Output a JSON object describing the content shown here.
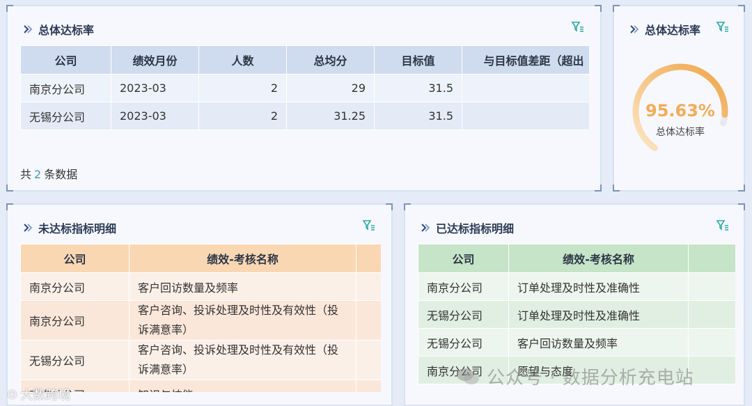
{
  "colors": {
    "page_bg": "#e5ecf7",
    "panel_bg": "#f7f8fe",
    "gauge_accent": "#f2ac57",
    "count_accent": "#3e9ab4",
    "filter_icon": "#2da9a5",
    "unmet_header": "#fad7b3",
    "met_header": "#c6e4c8",
    "overall_header": "#cfdcef"
  },
  "overall_table_panel": {
    "title": "总体达标率",
    "columns": [
      "公司",
      "绩效月份",
      "人数",
      "总均分",
      "目标值",
      "与目标值差距（超出"
    ],
    "rows": [
      [
        "南京分公司",
        "2023-03",
        "2",
        "29",
        "31.5",
        ""
      ],
      [
        "无锡分公司",
        "2023-03",
        "2",
        "31.25",
        "31.5",
        ""
      ]
    ],
    "footer_prefix": "共",
    "footer_count": "2",
    "footer_suffix": "条数据"
  },
  "overall_gauge_panel": {
    "title": "总体达标率",
    "value_text": "95.63%",
    "value_fraction": 0.9563,
    "label": "总体达标率"
  },
  "unmet_panel": {
    "title": "未达标指标明细",
    "columns": [
      "公司",
      "绩效-考核名称"
    ],
    "rows": [
      [
        "南京分公司",
        "客户回访数量及频率"
      ],
      [
        "南京分公司",
        "客户咨询、投诉处理及时性及有效性（投诉满意率）"
      ],
      [
        "无锡分公司",
        "客户咨询、投诉处理及时性及有效性（投诉满意率）"
      ],
      [
        "南京分公司",
        "知识与技能"
      ]
    ]
  },
  "met_panel": {
    "title": "已达标指标明细",
    "columns": [
      "公司",
      "绩效-考核名称"
    ],
    "rows": [
      [
        "南京分公司",
        "订单处理及时性及准确性"
      ],
      [
        "无锡分公司",
        "订单处理及时性及准确性"
      ],
      [
        "无锡分公司",
        "客户回访数量及频率"
      ],
      [
        "南京分公司",
        "愿望与态度"
      ]
    ]
  },
  "watermark": {
    "right": "公众号 · 数据分析充电站",
    "left": "大数跨境"
  }
}
